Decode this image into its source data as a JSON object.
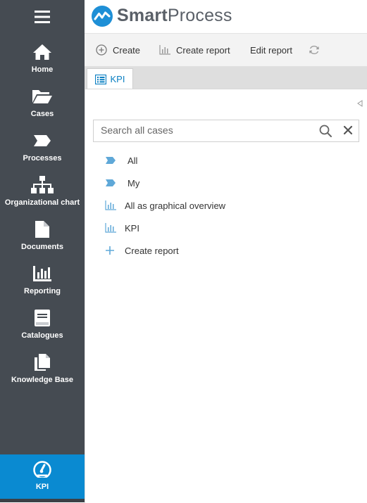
{
  "app": {
    "logo_smart": "Smart",
    "logo_process": "Process"
  },
  "sidebar": {
    "items": [
      {
        "label": "Home",
        "icon": "home-icon"
      },
      {
        "label": "Cases",
        "icon": "folder-open-icon"
      },
      {
        "label": "Processes",
        "icon": "process-tag-icon"
      },
      {
        "label": "Organizational chart",
        "icon": "org-chart-icon"
      },
      {
        "label": "Documents",
        "icon": "document-icon"
      },
      {
        "label": "Reporting",
        "icon": "bar-chart-icon"
      },
      {
        "label": "Catalogues",
        "icon": "catalogue-icon"
      },
      {
        "label": "Knowledge Base",
        "icon": "copy-icon"
      }
    ],
    "active": {
      "label": "KPI",
      "icon": "speedometer-icon"
    }
  },
  "toolbar": {
    "create_label": "Create",
    "create_report_label": "Create report",
    "edit_report_label": "Edit report"
  },
  "tabs": [
    {
      "label": "KPI",
      "icon": "list-icon"
    }
  ],
  "search": {
    "placeholder": "Search all cases"
  },
  "list": [
    {
      "label": "All",
      "icon": "tag-icon"
    },
    {
      "label": "My",
      "icon": "tag-icon"
    },
    {
      "label": "All as graphical overview",
      "icon": "chart-icon"
    },
    {
      "label": "KPI",
      "icon": "chart-icon"
    },
    {
      "label": "Create report",
      "icon": "plus-icon"
    }
  ],
  "colors": {
    "sidebar_bg": "#454b52",
    "accent": "#0a8ad1",
    "tag_blue": "#5fa8d8",
    "logo_text": "#5a6068"
  }
}
